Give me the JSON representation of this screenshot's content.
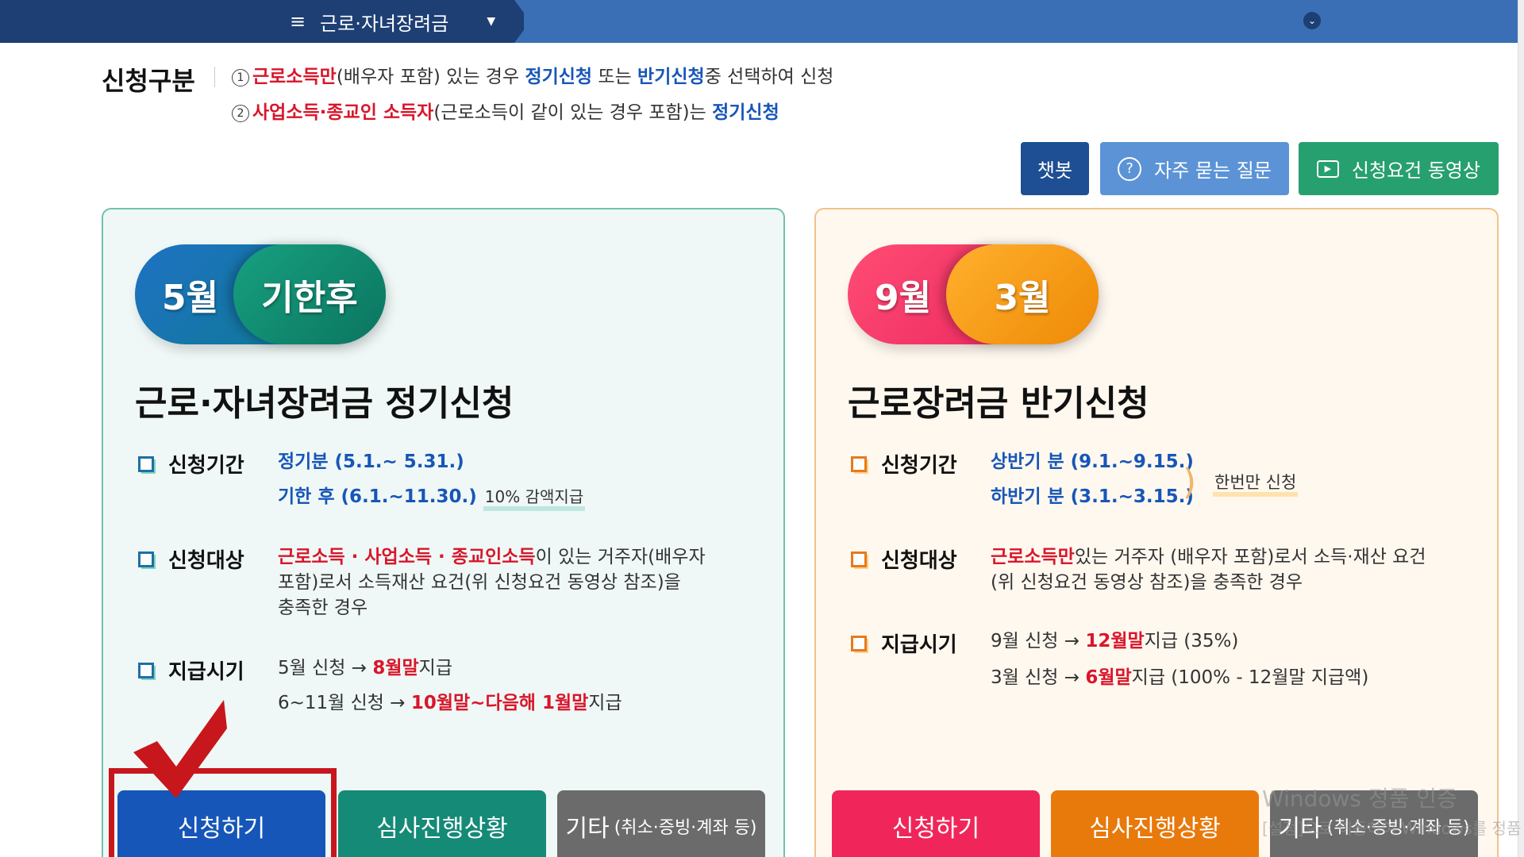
{
  "nav": {
    "menu_label": "근로·자녀장려금"
  },
  "category": {
    "title": "신청구분",
    "line1": {
      "num": "1",
      "a": "근로소득만",
      "b": "(배우자 포함) 있는 경우 ",
      "c": "정기신청",
      "d": " 또는 ",
      "e": "반기신청",
      "f": "중 선택하여 신청"
    },
    "line2": {
      "num": "2",
      "a": "사업소득·종교인 소득자",
      "b": "(근로소득이 같이 있는 경우 포함)는 ",
      "c": "정기신청"
    }
  },
  "toolbar": {
    "chatbot": "챗봇",
    "faq": "자주 묻는 질문",
    "video": "신청요건 동영상"
  },
  "left": {
    "pill1": "5월",
    "pill2": "기한후",
    "title": "근로·자녀장려금 정기신청",
    "period_label": "신청기간",
    "period1": "정기분 (5.1.~ 5.31.)",
    "period2": "기한 후 (6.1.~11.30.)",
    "period2_note": "10% 감액지급",
    "target_label": "신청대상",
    "target_red": "근로소득 · 사업소득 · 종교인소득",
    "target_rest1": "이 있는 거주자(배우자",
    "target_line2": "포함)로서 소득재산 요건(위 신청요건 동영상 참조)을",
    "target_line3": "충족한 경우",
    "pay_label": "지급시기",
    "pay1_a": "5월 신청 → ",
    "pay1_b": "8월말",
    "pay1_c": "지급",
    "pay2_a": "6~11월 신청 → ",
    "pay2_b": "10월말~다음해 1월말",
    "pay2_c": "지급",
    "btn_apply": "신청하기",
    "btn_status": "심사진행상황",
    "btn_etc": "기타",
    "btn_etc_sub": "(취소·증빙·계좌 등)"
  },
  "right": {
    "pill1": "9월",
    "pill2": "3월",
    "title": "근로장려금 반기신청",
    "period_label": "신청기간",
    "period1": "상반기 분 (9.1.~9.15.)",
    "period2": "하반기 분 (3.1.~3.15.)",
    "period_note": "한번만 신청",
    "target_label": "신청대상",
    "target_red": "근로소득만",
    "target_rest1": "있는 거주자 (배우자 포함)로서 소득·재산 요건",
    "target_line2": "(위 신청요건 동영상 참조)을 충족한 경우",
    "pay_label": "지급시기",
    "pay1_a": "9월 신청 → ",
    "pay1_b": "12월말",
    "pay1_c": "지급 (35%)",
    "pay2_a": "3월 신청 → ",
    "pay2_b": "6월말",
    "pay2_c": "지급 (100% - 12월말 지급액)",
    "btn_apply": "신청하기",
    "btn_status": "심사진행상황",
    "btn_etc": "기타",
    "btn_etc_sub": "(취소·증빙·계좌 등)"
  },
  "watermark": {
    "line1": "Windows 정품 인증",
    "line2": "[설정]으로 이동하여 Windows를 정품"
  },
  "colors": {
    "nav_dark": "#1e3f73",
    "nav": "#3a6fb5",
    "red": "#d9162b",
    "blue": "#1756b8",
    "green": "#158a77",
    "pink": "#f0265a",
    "orange": "#e8790b",
    "gray": "#6b6b6b"
  }
}
